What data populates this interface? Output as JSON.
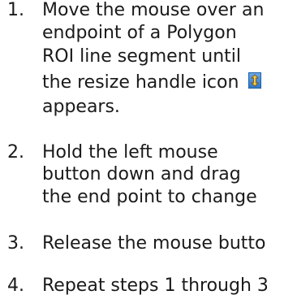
{
  "steps": [
    {
      "number": "1.",
      "lines": [
        "Move the mouse over an",
        "endpoint of a Polygon",
        "ROI line segment until",
        "the resize handle icon",
        "appears."
      ],
      "icon": "resize-handle-icon"
    },
    {
      "number": "2.",
      "lines": [
        "Hold the left mouse",
        "button down and drag",
        "the end point to change"
      ]
    },
    {
      "number": "3.",
      "lines": [
        "Release the mouse butto"
      ]
    },
    {
      "number": "4.",
      "lines": [
        "Repeat steps 1 through 3"
      ]
    }
  ],
  "colors": {
    "text": "#1a1a1a",
    "icon_fill": "#2f76c8",
    "icon_arrow": "#f2c94c"
  }
}
